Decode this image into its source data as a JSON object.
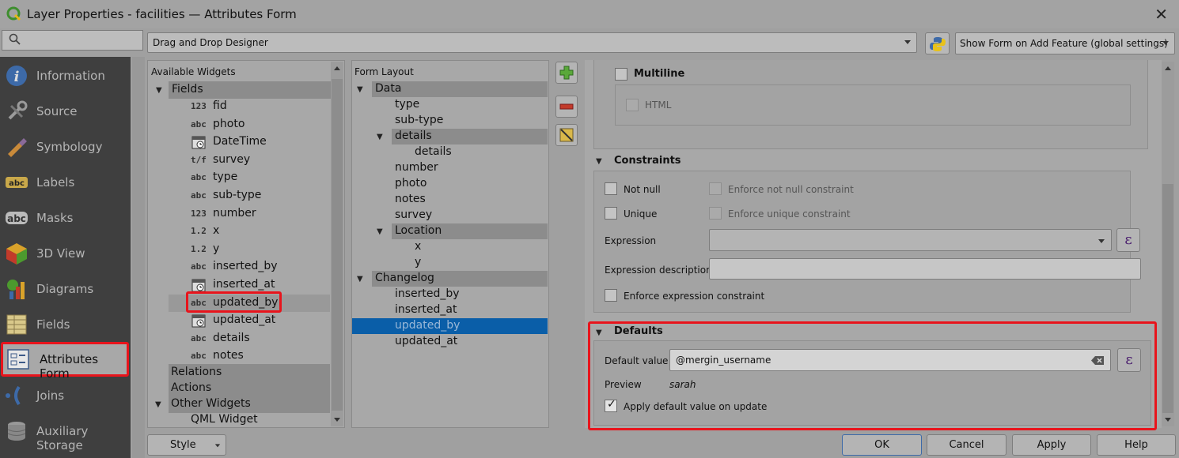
{
  "window": {
    "title": "Layer Properties - facilities — Attributes Form"
  },
  "nav": {
    "items": [
      {
        "label": "Information",
        "icon": "info-icon"
      },
      {
        "label": "Source",
        "icon": "source-icon"
      },
      {
        "label": "Symbology",
        "icon": "symbology-icon"
      },
      {
        "label": "Labels",
        "icon": "labels-icon"
      },
      {
        "label": "Masks",
        "icon": "masks-icon"
      },
      {
        "label": "3D View",
        "icon": "cube-icon"
      },
      {
        "label": "Diagrams",
        "icon": "diagrams-icon"
      },
      {
        "label": "Fields",
        "icon": "fields-icon"
      },
      {
        "label": "Attributes Form",
        "icon": "attributes-form-icon"
      },
      {
        "label": "Joins",
        "icon": "joins-icon"
      },
      {
        "label": "Auxiliary Storage",
        "icon": "database-icon"
      }
    ]
  },
  "header": {
    "designer_value": "Drag and Drop Designer",
    "show_form_value": "Show Form on Add Feature (global settings)"
  },
  "available": {
    "title": "Available Widgets",
    "fields_group": "Fields",
    "fields": [
      {
        "type": "123",
        "name": "fid"
      },
      {
        "type": "abc",
        "name": "photo"
      },
      {
        "type": "date",
        "name": "DateTime"
      },
      {
        "type": "t/f",
        "name": "survey"
      },
      {
        "type": "abc",
        "name": "type"
      },
      {
        "type": "abc",
        "name": "sub-type"
      },
      {
        "type": "123",
        "name": "number"
      },
      {
        "type": "1.2",
        "name": "x"
      },
      {
        "type": "1.2",
        "name": "y"
      },
      {
        "type": "abc",
        "name": "inserted_by"
      },
      {
        "type": "date",
        "name": "inserted_at"
      },
      {
        "type": "abc",
        "name": "updated_by"
      },
      {
        "type": "date",
        "name": "updated_at"
      },
      {
        "type": "abc",
        "name": "details"
      },
      {
        "type": "abc",
        "name": "notes"
      }
    ],
    "relations": "Relations",
    "actions": "Actions",
    "other_widgets": "Other Widgets",
    "qml_widget": "QML Widget"
  },
  "layout": {
    "title": "Form Layout",
    "data": "Data",
    "type": "type",
    "subtype": "sub-type",
    "details_group": "details",
    "details": "details",
    "number": "number",
    "photo": "photo",
    "notes": "notes",
    "survey": "survey",
    "location": "Location",
    "x": "x",
    "y": "y",
    "changelog": "Changelog",
    "inserted_by": "inserted_by",
    "inserted_at": "inserted_at",
    "updated_by": "updated_by",
    "updated_at": "updated_at"
  },
  "widget": {
    "multiline": "Multiline",
    "html": "HTML"
  },
  "constraints": {
    "title": "Constraints",
    "not_null": "Not null",
    "enforce_not_null": "Enforce not null constraint",
    "unique": "Unique",
    "enforce_unique": "Enforce unique constraint",
    "expression": "Expression",
    "expression_description": "Expression description",
    "enforce_expression": "Enforce expression constraint"
  },
  "defaults": {
    "title": "Defaults",
    "default_value_label": "Default value",
    "default_value": "@mergin_username",
    "preview_label": "Preview",
    "preview_value": "sarah",
    "apply_on_update": "Apply default value on update"
  },
  "buttons": {
    "style": "Style",
    "ok": "OK",
    "cancel": "Cancel",
    "apply": "Apply",
    "help": "Help"
  },
  "colors": {
    "highlight": "#e8141c",
    "selection": "#0a5ea8"
  }
}
